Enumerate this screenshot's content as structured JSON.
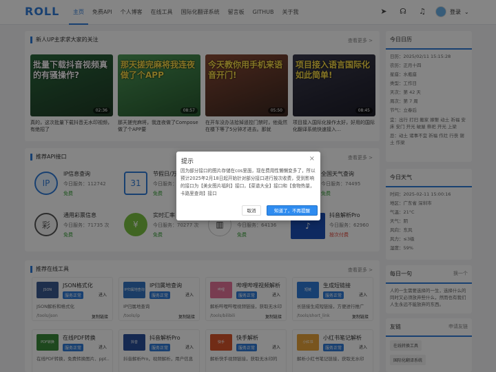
{
  "header": {
    "logo": "ROLL",
    "nav": [
      "主页",
      "免费API",
      "个人博客",
      "在线工具",
      "国际化翻译系统",
      "留言板",
      "GITHUB",
      "关于我"
    ],
    "login": "登录",
    "icons": [
      "send-icon",
      "headset-icon",
      "bell-icon",
      "user-avatar"
    ]
  },
  "sec1": {
    "title": "新人UP主求求大家的关注",
    "more": "查看更多 >",
    "videos": [
      {
        "cap": "批量下载抖音视频真的有骚操作?",
        "dur": "02:36",
        "title": "真的，这次批量下载抖音无水印视频，有绝招了",
        "color": "#2c6a3e"
      },
      {
        "cap": "那天搓完麻将我连夜做了个APP",
        "dur": "08:57",
        "title": "那天搓完麻将，我连夜做了Compose做了个APP要",
        "color": "#3f8a4a"
      },
      {
        "cap": "今天教你用手机来语音开门!",
        "dur": "05:50",
        "title": "在开车没办法拾掉遥控门禁时，他竟然在楼下等了5分钟才进去。那就",
        "color": "#7b3b2a"
      },
      {
        "cap": "项目接入语言国际化如此简单!",
        "dur": "08:45",
        "title": "项目接入国际化操作太好，好用的国际化翻译系统快速接入…",
        "color": "#2b2b3a"
      }
    ]
  },
  "sec2": {
    "title": "推荐API接口",
    "more": "查看更多 >",
    "apis": [
      {
        "name": "IP信息查询",
        "svc": "今日服务：112742",
        "fee": "免费",
        "icon": "IP"
      },
      {
        "name": "节假日/万年历",
        "svc": "今日服务：",
        "fee": "免费",
        "icon": "31"
      },
      {
        "name": "",
        "svc": "",
        "fee": "",
        "icon": ""
      },
      {
        "name": "全国天气查询",
        "svc": "今日服务：74495",
        "fee": "免费",
        "icon": "☁"
      },
      {
        "name": "通用彩票信息",
        "svc": "今日服务：71735 次",
        "fee": "免费",
        "icon": "彩"
      },
      {
        "name": "实时汇率",
        "svc": "今日服务：70277 次",
        "fee": "免费",
        "icon": "¥"
      },
      {
        "name": "",
        "svc": "今日服务：64136",
        "fee": "免费",
        "icon": "▥"
      },
      {
        "name": "抖音解析Pro",
        "svc": "今日服务：62960",
        "fee": "按次付费",
        "icon": "♪"
      }
    ]
  },
  "dialog": {
    "title": "提示",
    "body": "因为部分接口的图片存储在cos里面，现在费用性懒懒变多了，所以预计2025年2月18日起开始针对部分接口进行按次收费，受到影响的接口为【美女图片福利】接口，【菜谱大全】接口和【食物热量，卡路里查询】接口",
    "cancel": "取消",
    "ok": "知道了，不再提醒"
  },
  "sec3": {
    "title": "推荐在线工具",
    "more": "查看更多 >",
    "tools": [
      {
        "name": "JSON格式化",
        "badge": "服务正常",
        "enter": "进入",
        "desc": "JSON解析和格式化",
        "path": "/tools/json",
        "copy": "复制链接",
        "icon": "JSON",
        "color": "#3b5b92"
      },
      {
        "name": "IP归属地查询",
        "badge": "服务正常",
        "enter": "进入",
        "desc": "IP归属地查询",
        "path": "/tools/ip",
        "copy": "复制链接",
        "icon": "IP归属地查询",
        "color": "#3476c4"
      },
      {
        "name": "哔哩哔哩视频解析",
        "badge": "服务正常",
        "enter": "进入",
        "desc": "解析哔哩哔哩视频链接，获取无水印",
        "path": "/tools/bilibili",
        "copy": "复制链接",
        "icon": "哔哩",
        "color": "#e7749a"
      },
      {
        "name": "生成短链接",
        "badge": "服务正常",
        "enter": "进入",
        "desc": "长链接生成短链接，方便进行推广",
        "path": "/tools/short_link",
        "copy": "复制链接",
        "icon": "短链",
        "color": "#2f7bd8"
      },
      {
        "name": "在线PDF转换",
        "badge": "服务正常",
        "enter": "进入",
        "desc": "在线PDF转换，免费转换图片、ppt…",
        "path": "",
        "copy": "",
        "icon": "PDF转换",
        "color": "#3a8a3a"
      },
      {
        "name": "抖音解析Pro",
        "badge": "服务正常",
        "enter": "进入",
        "desc": "抖音解析Pro，视频解析，用户信息",
        "path": "",
        "copy": "",
        "icon": "抖音",
        "color": "#2a4f9c"
      },
      {
        "name": "快手解析",
        "badge": "服务正常",
        "enter": "进入",
        "desc": "解析快手视频链接，获取无水印的",
        "path": "",
        "copy": "",
        "icon": "快手",
        "color": "#d9552b"
      },
      {
        "name": "小红书笔记解析",
        "badge": "服务正常",
        "enter": "进入",
        "desc": "解析小红书笔记链接，获取无水印",
        "path": "",
        "copy": "",
        "icon": "小红书",
        "color": "#e8a33a"
      }
    ]
  },
  "calendar": {
    "title": "今日日历",
    "rows": [
      "日历：2025/02/11 15:15:28",
      "农历：正月十四",
      "星座：水瓶座",
      "类型：工作日",
      "天次：第 42 天",
      "周次：第 7 周",
      "节气：立春后",
      "宜：出行 打扫 搬家 嫁娶 动土 祈福 安床 安门 开光 破屋 祭祀 开光 上梁",
      "忌：动土 诸事不宜 祈福 作灶 行丧 谢土 作梁"
    ]
  },
  "weather": {
    "title": "今日天气",
    "rows": [
      "时间：2025-02-11 15:00:16",
      "地区：广东省 深圳市",
      "气温：21°C",
      "天气：阴",
      "风向：东风",
      "风力：≤3级",
      "湿度：59%"
    ]
  },
  "quote": {
    "title": "每日一句",
    "change": "换一个",
    "text": "人的一生需要选择的一生，选择什么的同时又必须放弃些什么，然而也有我们人生永远不能放弃的东西。"
  },
  "links": {
    "title": "友链",
    "apply": "申请友链",
    "items": [
      "在线转换工具",
      "国际化翻译系统",
      "…"
    ]
  }
}
